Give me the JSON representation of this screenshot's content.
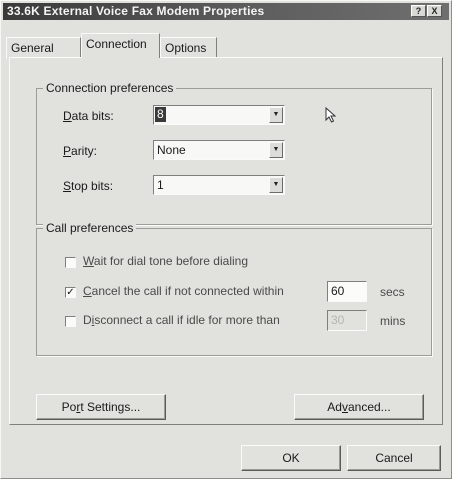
{
  "window": {
    "title": "33.6K External Voice Fax Modem Properties",
    "help_glyph": "?",
    "close_glyph": "X"
  },
  "tabs": [
    {
      "label": "General",
      "active": false
    },
    {
      "label": "Connection",
      "active": true
    },
    {
      "label": "Options",
      "active": false
    }
  ],
  "connection_preferences": {
    "legend": "Connection preferences",
    "data_bits": {
      "mnemonic": "D",
      "rest": "ata bits:",
      "value": "8"
    },
    "parity": {
      "mnemonic": "P",
      "rest": "arity:",
      "value": "None"
    },
    "stop_bits": {
      "mnemonic": "S",
      "rest": "top bits:",
      "value": "1"
    }
  },
  "call_preferences": {
    "legend": "Call preferences",
    "wait_dial_tone": {
      "mnemonic": "W",
      "rest": "ait for dial tone before dialing",
      "checked": false
    },
    "cancel_call": {
      "mnemonic": "C",
      "rest": "ancel the call if not connected within",
      "checked": true,
      "value": "60",
      "unit": "secs"
    },
    "disconnect_idle": {
      "pre": "D",
      "mnemonic": "i",
      "rest": "sconnect a call if idle for more than",
      "checked": false,
      "value": "30",
      "unit": "mins"
    }
  },
  "buttons": {
    "port_settings": {
      "pre": "Po",
      "mnemonic": "r",
      "rest": "t Settings..."
    },
    "advanced": {
      "pre": "Ad",
      "mnemonic": "v",
      "rest": "anced..."
    },
    "ok": "OK",
    "cancel": "Cancel"
  },
  "icons": {
    "dropdown_arrow": "▼",
    "check_mark": "✓"
  }
}
